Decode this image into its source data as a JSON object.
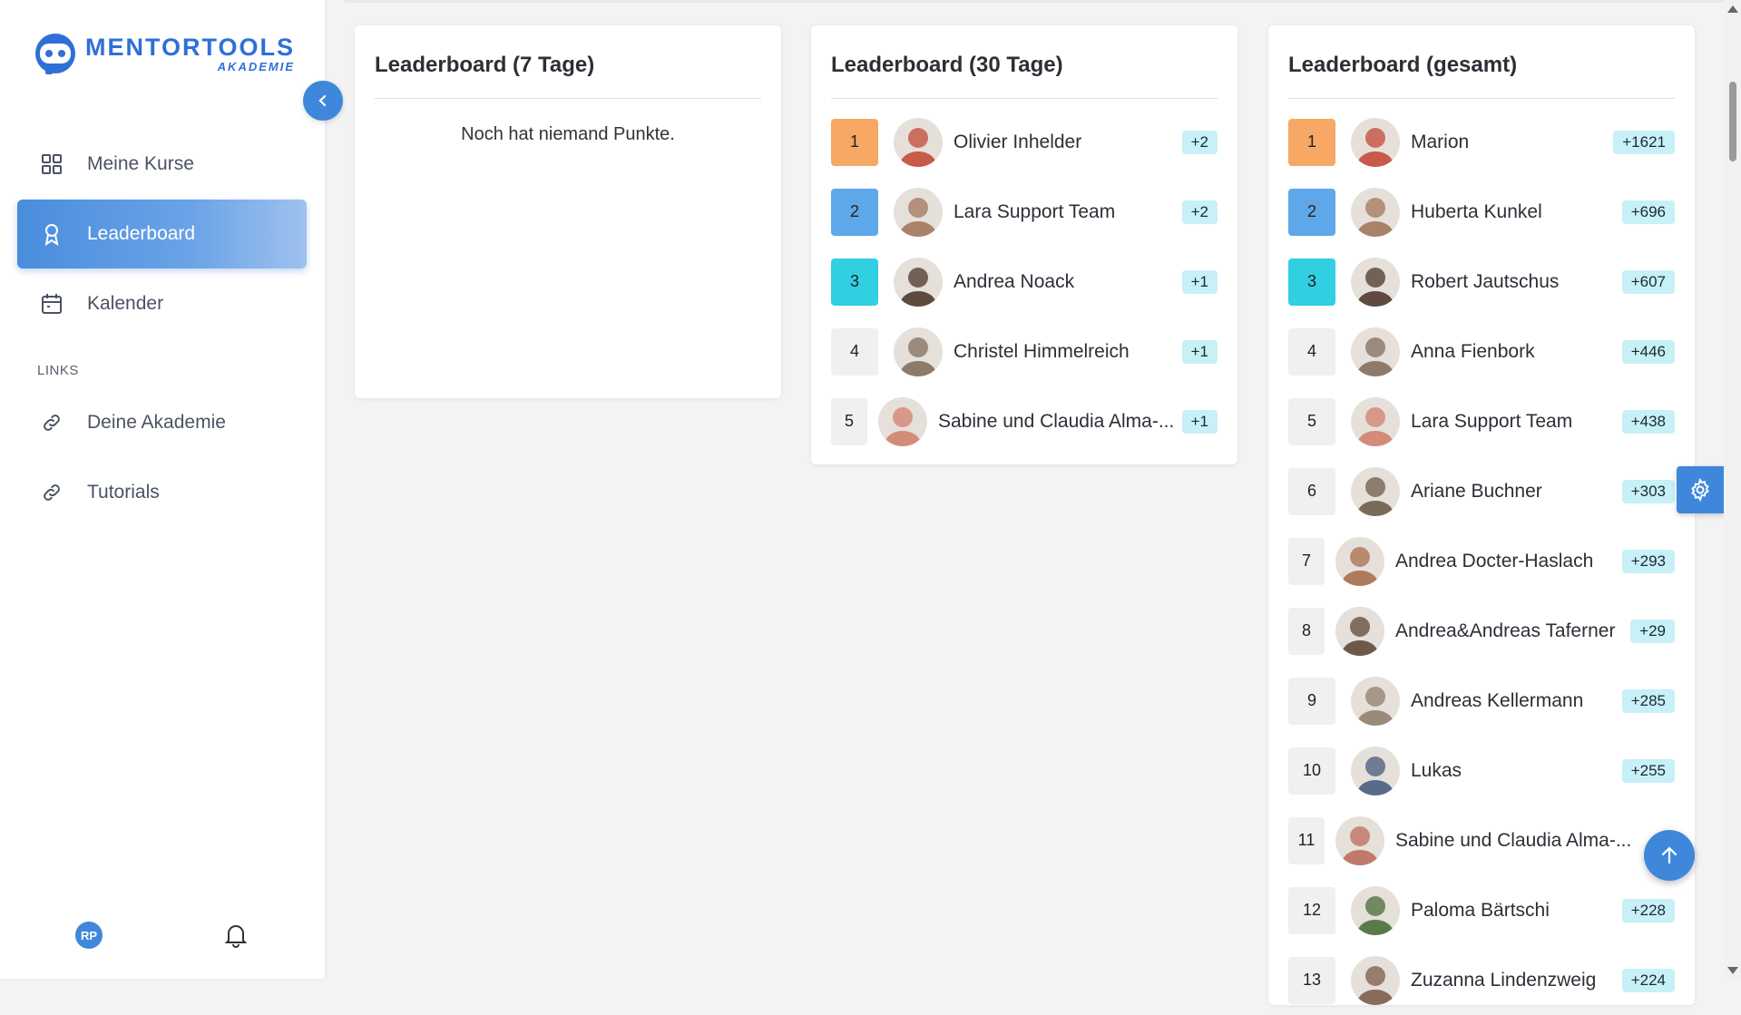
{
  "brand": {
    "name": "MENTORTOOLS",
    "sub": "AKADEMIE"
  },
  "nav": [
    {
      "label": "Meine Kurse",
      "icon": "grid-icon",
      "active": false
    },
    {
      "label": "Leaderboard",
      "icon": "award-icon",
      "active": true
    },
    {
      "label": "Kalender",
      "icon": "calendar-icon",
      "active": false
    }
  ],
  "links_section": "LINKS",
  "links": [
    {
      "label": "Deine Akademie",
      "icon": "link-icon"
    },
    {
      "label": "Tutorials",
      "icon": "link-icon"
    }
  ],
  "user": {
    "initials": "RP"
  },
  "boards": {
    "week": {
      "title": "Leaderboard (7 Tage)",
      "empty": "Noch hat niemand Punkte."
    },
    "month": {
      "title": "Leaderboard (30 Tage)",
      "entries": [
        {
          "rank": "1",
          "name": "Olivier Inhelder",
          "points": "+2"
        },
        {
          "rank": "2",
          "name": "Lara Support Team",
          "points": "+2"
        },
        {
          "rank": "3",
          "name": "Andrea Noack",
          "points": "+1"
        },
        {
          "rank": "4",
          "name": "Christel Himmelreich",
          "points": "+1"
        },
        {
          "rank": "5",
          "name": "Sabine und Claudia Alma-...",
          "points": "+1"
        }
      ]
    },
    "total": {
      "title": "Leaderboard (gesamt)",
      "entries": [
        {
          "rank": "1",
          "name": "Marion",
          "points": "+1621"
        },
        {
          "rank": "2",
          "name": "Huberta Kunkel",
          "points": "+696"
        },
        {
          "rank": "3",
          "name": "Robert Jautschus",
          "points": "+607"
        },
        {
          "rank": "4",
          "name": "Anna Fienbork",
          "points": "+446"
        },
        {
          "rank": "5",
          "name": "Lara Support Team",
          "points": "+438"
        },
        {
          "rank": "6",
          "name": "Ariane Buchner",
          "points": "+303"
        },
        {
          "rank": "7",
          "name": "Andrea Docter-Haslach",
          "points": "+293"
        },
        {
          "rank": "8",
          "name": "Andrea&Andreas Taferner",
          "points": "+29"
        },
        {
          "rank": "9",
          "name": "Andreas Kellermann",
          "points": "+285"
        },
        {
          "rank": "10",
          "name": "Lukas",
          "points": "+255"
        },
        {
          "rank": "11",
          "name": "Sabine und Claudia Alma-...",
          "points": ""
        },
        {
          "rank": "12",
          "name": "Paloma Bärtschi",
          "points": "+228"
        },
        {
          "rank": "13",
          "name": "Zuzanna Lindenzweig",
          "points": "+224"
        }
      ]
    }
  },
  "colors": {
    "accent": "#3f87db",
    "rank1": "#f7a864",
    "rank2": "#5ea8ea",
    "rank3": "#31cfe2",
    "points_bg": "#c7f0f7"
  }
}
